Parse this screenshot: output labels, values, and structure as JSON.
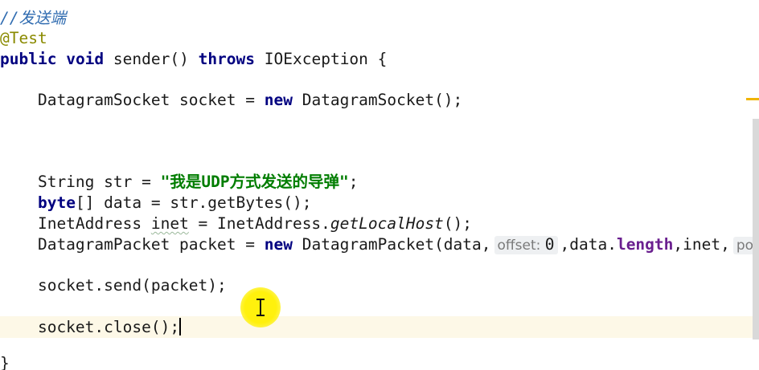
{
  "editor": {
    "comment": "//发送端",
    "annotation": "@Test",
    "method": {
      "kw_public": "public",
      "kw_void": "void",
      "signature": " sender() ",
      "kw_throws": "throws",
      "tail": " IOException {"
    },
    "line_socket": {
      "prefix": "    DatagramSocket socket = ",
      "kw_new": "new",
      "suffix": " DatagramSocket();"
    },
    "line_string": {
      "prefix": "    String str = ",
      "literal": "\"我是UDP方式发送的导弹\"",
      "suffix": ";"
    },
    "line_byte": {
      "indent": "    ",
      "kw_byte": "byte",
      "suffix": "[] data = str.getBytes();"
    },
    "line_inet": {
      "prefix": "    InetAddress ",
      "var": "inet",
      "mid": " = InetAddress.",
      "method": "getLocalHost",
      "suffix": "();"
    },
    "line_packet": {
      "prefix": "    DatagramPacket packet = ",
      "kw_new": "new",
      "mid": " DatagramPacket(data,",
      "hint1_label": "offset:",
      "hint1_value": "0",
      "mid2": ",data.",
      "field": "length",
      "mid3": ",inet,",
      "hint2_label": "po"
    },
    "line_send": "    socket.send(packet);",
    "line_close": "    socket.close();",
    "closing_brace": "}"
  },
  "colors": {
    "keyword": "#000080",
    "string": "#007d00",
    "comment": "#2f6bb0",
    "annotation": "#8a8a00",
    "field": "#6a1f8f",
    "current_line": "#fdf8e7",
    "cursor_highlight": "#fff000"
  },
  "icons": {
    "text_cursor": "i-beam-icon"
  }
}
